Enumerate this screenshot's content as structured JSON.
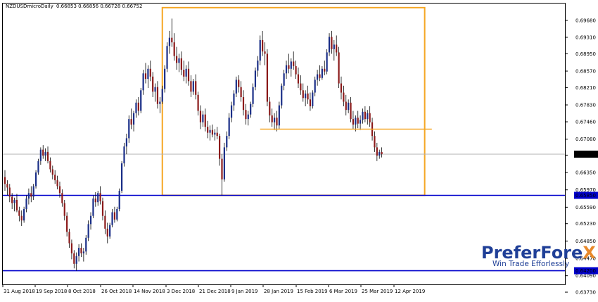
{
  "header": {
    "symbol_text": "NZDUSDmicroDaily",
    "ohlc_text": "0.66853 0.66856 0.66728 0.66752"
  },
  "watermark": {
    "brand_part1": "Prefer",
    "brand_part2": "Fore",
    "brand_part3": "X",
    "tagline": "Win Trade Efforlessly",
    "colors": {
      "prefer": "#1f3f97",
      "fore": "#1f3f97",
      "x": "#e8892b",
      "tagline": "#1f3f97"
    }
  },
  "chart_data": {
    "type": "candlestick",
    "title": "",
    "timeframe": "Daily",
    "ylim": [
      0.639,
      0.7005
    ],
    "y_ticks": [
      "0.69680",
      "0.69310",
      "0.68950",
      "0.68570",
      "0.68210",
      "0.67830",
      "0.67460",
      "0.67080",
      "0.66730",
      "0.66350",
      "0.65970",
      "0.65590",
      "0.65230",
      "0.64850",
      "0.64470",
      "0.64090",
      "0.63730"
    ],
    "x_labels": [
      "31 Aug 2018",
      "19 Sep 2018",
      "8 Oct 2018",
      "26 Oct 2018",
      "14 Nov 2018",
      "3 Dec 2018",
      "21 Dec 2018",
      "9 Jan 2019",
      "28 Jan 2019",
      "15 Feb 2019",
      "6 Mar 2019",
      "25 Mar 2019",
      "12 Apr 2019"
    ],
    "current_price": {
      "value": 0.66752,
      "label": "0.66752"
    },
    "horizontal_levels": [
      {
        "value": 0.6585,
        "label": "0.65850",
        "color": "#0000cc"
      },
      {
        "value": 0.642,
        "label": "0.64200",
        "color": "#0000cc"
      }
    ],
    "range_box": {
      "start_index": 66,
      "end_index": 176,
      "top": 0.6996,
      "bottom": 0.6585,
      "color": "#f5a623"
    },
    "support_line": {
      "start_index": 107,
      "end_index": 179,
      "value": 0.673,
      "color": "#f5a623"
    },
    "colors": {
      "up": "#1b2f88",
      "down": "#8b1a1a",
      "wick": "#000000"
    },
    "candles": [
      [
        0.6625,
        0.664,
        0.6595,
        0.661
      ],
      [
        0.661,
        0.6618,
        0.6585,
        0.6602
      ],
      [
        0.6602,
        0.661,
        0.657,
        0.6582
      ],
      [
        0.6582,
        0.659,
        0.6555,
        0.6568
      ],
      [
        0.6568,
        0.658,
        0.655,
        0.6575
      ],
      [
        0.6575,
        0.6588,
        0.6548,
        0.6552
      ],
      [
        0.6552,
        0.656,
        0.6528,
        0.654
      ],
      [
        0.654,
        0.6552,
        0.6518,
        0.653
      ],
      [
        0.653,
        0.656,
        0.6525,
        0.6555
      ],
      [
        0.6555,
        0.6585,
        0.6548,
        0.6578
      ],
      [
        0.6578,
        0.66,
        0.6565,
        0.659
      ],
      [
        0.659,
        0.6605,
        0.657,
        0.6582
      ],
      [
        0.6582,
        0.661,
        0.6575,
        0.6605
      ],
      [
        0.6605,
        0.664,
        0.66,
        0.6635
      ],
      [
        0.6635,
        0.6665,
        0.663,
        0.666
      ],
      [
        0.666,
        0.669,
        0.6652,
        0.6685
      ],
      [
        0.6685,
        0.6695,
        0.6665,
        0.6672
      ],
      [
        0.6672,
        0.6688,
        0.666,
        0.668
      ],
      [
        0.668,
        0.6692,
        0.6655,
        0.666
      ],
      [
        0.666,
        0.6668,
        0.6635,
        0.6642
      ],
      [
        0.6642,
        0.665,
        0.662,
        0.663
      ],
      [
        0.663,
        0.664,
        0.661,
        0.6618
      ],
      [
        0.6618,
        0.6628,
        0.6598,
        0.6605
      ],
      [
        0.6605,
        0.6615,
        0.658,
        0.659
      ],
      [
        0.659,
        0.6598,
        0.656,
        0.6568
      ],
      [
        0.6568,
        0.6575,
        0.653,
        0.654
      ],
      [
        0.654,
        0.6548,
        0.6495,
        0.6505
      ],
      [
        0.6505,
        0.6512,
        0.647,
        0.648
      ],
      [
        0.648,
        0.6488,
        0.6445,
        0.6458
      ],
      [
        0.6458,
        0.6465,
        0.6425,
        0.6435
      ],
      [
        0.6435,
        0.646,
        0.642,
        0.6452
      ],
      [
        0.6452,
        0.6478,
        0.644,
        0.647
      ],
      [
        0.647,
        0.648,
        0.645,
        0.6458
      ],
      [
        0.6458,
        0.647,
        0.644,
        0.6462
      ],
      [
        0.6462,
        0.6498,
        0.6455,
        0.6492
      ],
      [
        0.6492,
        0.653,
        0.6485,
        0.6522
      ],
      [
        0.6522,
        0.6548,
        0.651,
        0.654
      ],
      [
        0.654,
        0.6585,
        0.6535,
        0.6578
      ],
      [
        0.6578,
        0.6592,
        0.656,
        0.657
      ],
      [
        0.657,
        0.6595,
        0.6562,
        0.659
      ],
      [
        0.659,
        0.6605,
        0.6565,
        0.6572
      ],
      [
        0.6572,
        0.658,
        0.653,
        0.654
      ],
      [
        0.654,
        0.6552,
        0.65,
        0.6512
      ],
      [
        0.6512,
        0.6525,
        0.648,
        0.6495
      ],
      [
        0.6495,
        0.6525,
        0.649,
        0.652
      ],
      [
        0.652,
        0.6555,
        0.6515,
        0.6548
      ],
      [
        0.6548,
        0.656,
        0.6525,
        0.6532
      ],
      [
        0.6532,
        0.656,
        0.6528,
        0.6555
      ],
      [
        0.6555,
        0.66,
        0.655,
        0.6595
      ],
      [
        0.6595,
        0.666,
        0.659,
        0.6655
      ],
      [
        0.6655,
        0.67,
        0.6648,
        0.6692
      ],
      [
        0.6692,
        0.672,
        0.6675,
        0.671
      ],
      [
        0.671,
        0.676,
        0.67,
        0.6752
      ],
      [
        0.6752,
        0.6775,
        0.673,
        0.674
      ],
      [
        0.674,
        0.677,
        0.6725,
        0.6765
      ],
      [
        0.6765,
        0.6795,
        0.6755,
        0.6788
      ],
      [
        0.6788,
        0.68,
        0.676,
        0.677
      ],
      [
        0.677,
        0.682,
        0.6765,
        0.6815
      ],
      [
        0.6815,
        0.686,
        0.6805,
        0.6852
      ],
      [
        0.6852,
        0.6875,
        0.683,
        0.684
      ],
      [
        0.684,
        0.687,
        0.682,
        0.6862
      ],
      [
        0.6862,
        0.688,
        0.6835,
        0.6845
      ],
      [
        0.6845,
        0.6855,
        0.68,
        0.6812
      ],
      [
        0.6812,
        0.683,
        0.679,
        0.6822
      ],
      [
        0.6822,
        0.6835,
        0.6775,
        0.6785
      ],
      [
        0.6785,
        0.68,
        0.6765,
        0.679
      ],
      [
        0.679,
        0.6825,
        0.6785,
        0.6818
      ],
      [
        0.6818,
        0.687,
        0.681,
        0.6862
      ],
      [
        0.6862,
        0.692,
        0.6855,
        0.6912
      ],
      [
        0.6912,
        0.6945,
        0.6895,
        0.693
      ],
      [
        0.693,
        0.6972,
        0.691,
        0.692
      ],
      [
        0.692,
        0.694,
        0.688,
        0.689
      ],
      [
        0.689,
        0.691,
        0.686,
        0.6875
      ],
      [
        0.6875,
        0.6895,
        0.6855,
        0.6885
      ],
      [
        0.6885,
        0.69,
        0.6848,
        0.686
      ],
      [
        0.686,
        0.688,
        0.6835,
        0.6845
      ],
      [
        0.6845,
        0.687,
        0.683,
        0.6862
      ],
      [
        0.6862,
        0.6878,
        0.6825,
        0.6835
      ],
      [
        0.6835,
        0.6848,
        0.68,
        0.6812
      ],
      [
        0.6812,
        0.684,
        0.6805,
        0.6835
      ],
      [
        0.6835,
        0.685,
        0.6795,
        0.6805
      ],
      [
        0.6805,
        0.6812,
        0.676,
        0.677
      ],
      [
        0.677,
        0.6782,
        0.673,
        0.6745
      ],
      [
        0.6745,
        0.677,
        0.6735,
        0.6762
      ],
      [
        0.6762,
        0.6775,
        0.6725,
        0.6735
      ],
      [
        0.6735,
        0.6748,
        0.671,
        0.6722
      ],
      [
        0.6722,
        0.6738,
        0.6705,
        0.6728
      ],
      [
        0.6728,
        0.674,
        0.6712,
        0.6718
      ],
      [
        0.6718,
        0.673,
        0.6705,
        0.6722
      ],
      [
        0.6722,
        0.6735,
        0.6708,
        0.6715
      ],
      [
        0.6715,
        0.672,
        0.665,
        0.6665
      ],
      [
        0.6665,
        0.6675,
        0.6585,
        0.662
      ],
      [
        0.662,
        0.67,
        0.6615,
        0.669
      ],
      [
        0.669,
        0.6725,
        0.6682,
        0.6715
      ],
      [
        0.6715,
        0.6765,
        0.6708,
        0.6755
      ],
      [
        0.6755,
        0.679,
        0.6745,
        0.6782
      ],
      [
        0.6782,
        0.6815,
        0.677,
        0.6808
      ],
      [
        0.6808,
        0.6845,
        0.68,
        0.6838
      ],
      [
        0.6838,
        0.6848,
        0.681,
        0.6822
      ],
      [
        0.6822,
        0.6835,
        0.679,
        0.68
      ],
      [
        0.68,
        0.6815,
        0.676,
        0.6772
      ],
      [
        0.6772,
        0.6785,
        0.674,
        0.6752
      ],
      [
        0.6752,
        0.677,
        0.6738,
        0.6762
      ],
      [
        0.6762,
        0.679,
        0.6755,
        0.6785
      ],
      [
        0.6785,
        0.683,
        0.6778,
        0.6822
      ],
      [
        0.6822,
        0.6865,
        0.6815,
        0.6858
      ],
      [
        0.6858,
        0.689,
        0.6845,
        0.688
      ],
      [
        0.688,
        0.6935,
        0.687,
        0.6925
      ],
      [
        0.6925,
        0.6945,
        0.689,
        0.69
      ],
      [
        0.69,
        0.692,
        0.687,
        0.6895
      ],
      [
        0.6895,
        0.6905,
        0.678,
        0.679
      ],
      [
        0.679,
        0.68,
        0.6745,
        0.676
      ],
      [
        0.676,
        0.6775,
        0.6735,
        0.6745
      ],
      [
        0.6745,
        0.6765,
        0.6728,
        0.6755
      ],
      [
        0.6755,
        0.677,
        0.6725,
        0.6738
      ],
      [
        0.6738,
        0.679,
        0.673,
        0.6782
      ],
      [
        0.6782,
        0.683,
        0.6775,
        0.6825
      ],
      [
        0.6825,
        0.686,
        0.6815,
        0.6852
      ],
      [
        0.6852,
        0.688,
        0.684,
        0.687
      ],
      [
        0.687,
        0.6895,
        0.6852,
        0.6862
      ],
      [
        0.6862,
        0.6885,
        0.6845,
        0.6878
      ],
      [
        0.6878,
        0.69,
        0.686,
        0.6868
      ],
      [
        0.6868,
        0.688,
        0.684,
        0.685
      ],
      [
        0.685,
        0.6865,
        0.682,
        0.683
      ],
      [
        0.683,
        0.6848,
        0.6805,
        0.6815
      ],
      [
        0.6815,
        0.683,
        0.679,
        0.6798
      ],
      [
        0.6798,
        0.6815,
        0.678,
        0.6808
      ],
      [
        0.6808,
        0.6825,
        0.6785,
        0.6795
      ],
      [
        0.6795,
        0.681,
        0.677,
        0.678
      ],
      [
        0.678,
        0.6815,
        0.6775,
        0.681
      ],
      [
        0.681,
        0.6845,
        0.6802,
        0.6838
      ],
      [
        0.6838,
        0.686,
        0.6825,
        0.685
      ],
      [
        0.685,
        0.687,
        0.6835,
        0.6842
      ],
      [
        0.6842,
        0.6868,
        0.6838,
        0.6862
      ],
      [
        0.6862,
        0.688,
        0.6848,
        0.6856
      ],
      [
        0.6856,
        0.6905,
        0.685,
        0.6898
      ],
      [
        0.6898,
        0.694,
        0.689,
        0.6932
      ],
      [
        0.6932,
        0.6945,
        0.6895,
        0.6905
      ],
      [
        0.6905,
        0.6925,
        0.688,
        0.6915
      ],
      [
        0.6915,
        0.6935,
        0.689,
        0.6898
      ],
      [
        0.6898,
        0.691,
        0.682,
        0.683
      ],
      [
        0.683,
        0.6845,
        0.6795,
        0.681
      ],
      [
        0.681,
        0.6825,
        0.678,
        0.679
      ],
      [
        0.679,
        0.6805,
        0.676,
        0.6772
      ],
      [
        0.6772,
        0.6795,
        0.6765,
        0.6788
      ],
      [
        0.6788,
        0.68,
        0.6745,
        0.6752
      ],
      [
        0.6752,
        0.677,
        0.673,
        0.674
      ],
      [
        0.674,
        0.676,
        0.6725,
        0.6755
      ],
      [
        0.6755,
        0.677,
        0.6732,
        0.6742
      ],
      [
        0.6742,
        0.676,
        0.6728,
        0.675
      ],
      [
        0.675,
        0.6775,
        0.6742,
        0.6768
      ],
      [
        0.6768,
        0.678,
        0.6745,
        0.6752
      ],
      [
        0.6752,
        0.6772,
        0.674,
        0.6765
      ],
      [
        0.6765,
        0.678,
        0.6735,
        0.6745
      ],
      [
        0.6745,
        0.6755,
        0.6705,
        0.6715
      ],
      [
        0.6715,
        0.6725,
        0.668,
        0.669
      ],
      [
        0.669,
        0.67,
        0.666,
        0.6672
      ],
      [
        0.6672,
        0.6685,
        0.6665,
        0.668
      ],
      [
        0.668,
        0.669,
        0.6668,
        0.6675
      ]
    ]
  }
}
